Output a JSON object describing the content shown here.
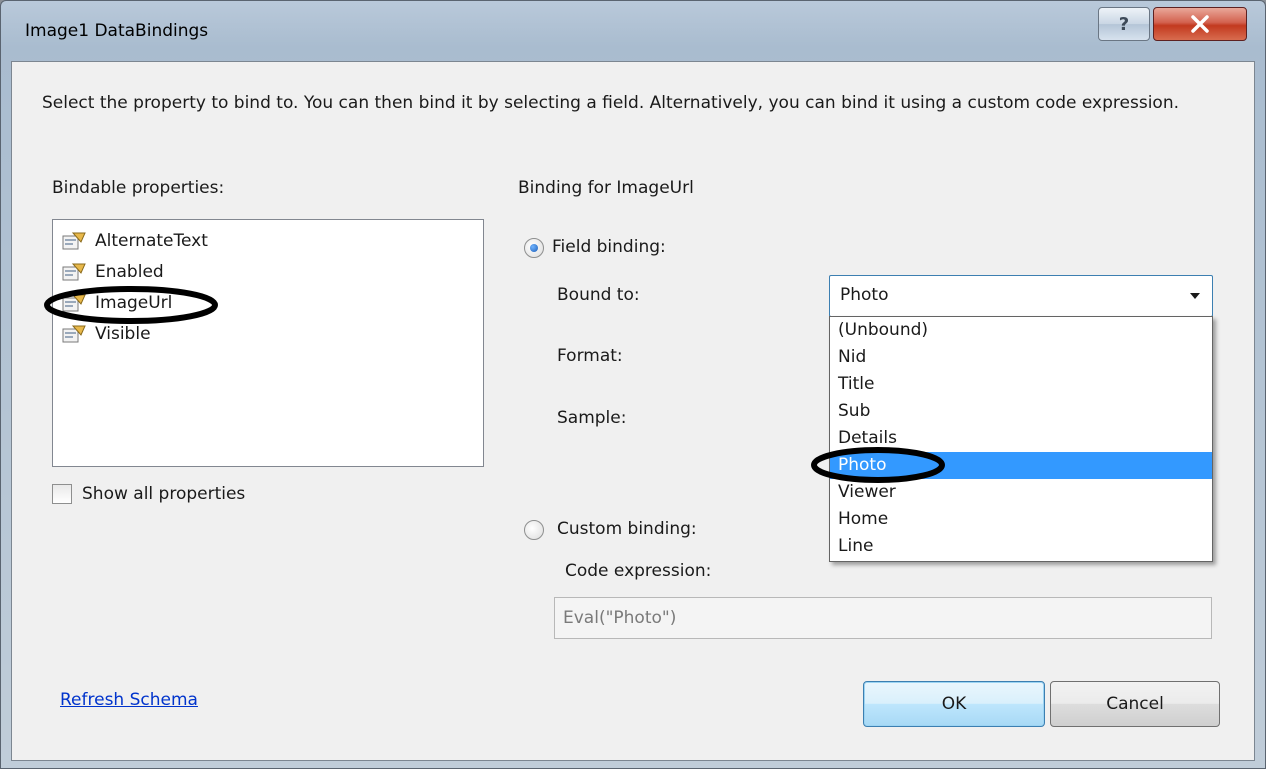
{
  "window": {
    "title": "Image1 DataBindings"
  },
  "intro_text": "Select the property to bind to. You can then bind it by selecting a field. Alternatively, you can bind it using a custom code expression.",
  "bindable": {
    "label": "Bindable properties:",
    "items": [
      "AlternateText",
      "Enabled",
      "ImageUrl",
      "Visible"
    ],
    "selected": "ImageUrl",
    "show_all_label": "Show all properties",
    "show_all_checked": false
  },
  "binding": {
    "header": "Binding for ImageUrl",
    "field_binding_label": "Field binding:",
    "field_binding_selected": true,
    "bound_to_label": "Bound to:",
    "bound_to_value": "Photo",
    "format_label": "Format:",
    "sample_label": "Sample:",
    "dropdown_options": [
      "(Unbound)",
      "Nid",
      "Title",
      "Sub",
      "Details",
      "Photo",
      "Viewer",
      "Home",
      "Line"
    ],
    "dropdown_selected": "Photo",
    "custom_binding_label": "Custom binding:",
    "custom_binding_selected": false,
    "code_expression_label": "Code expression:",
    "code_expression_value": "Eval(\"Photo\")"
  },
  "footer": {
    "refresh_link": "Refresh Schema",
    "ok_label": "OK",
    "cancel_label": "Cancel"
  },
  "icons": {
    "help": "help-icon",
    "close": "close-icon",
    "property": "property-icon",
    "dropdown": "chevron-down-icon"
  },
  "colors": {
    "selection": "#3399ff",
    "link": "#0033cc",
    "annotation": "#000000"
  }
}
